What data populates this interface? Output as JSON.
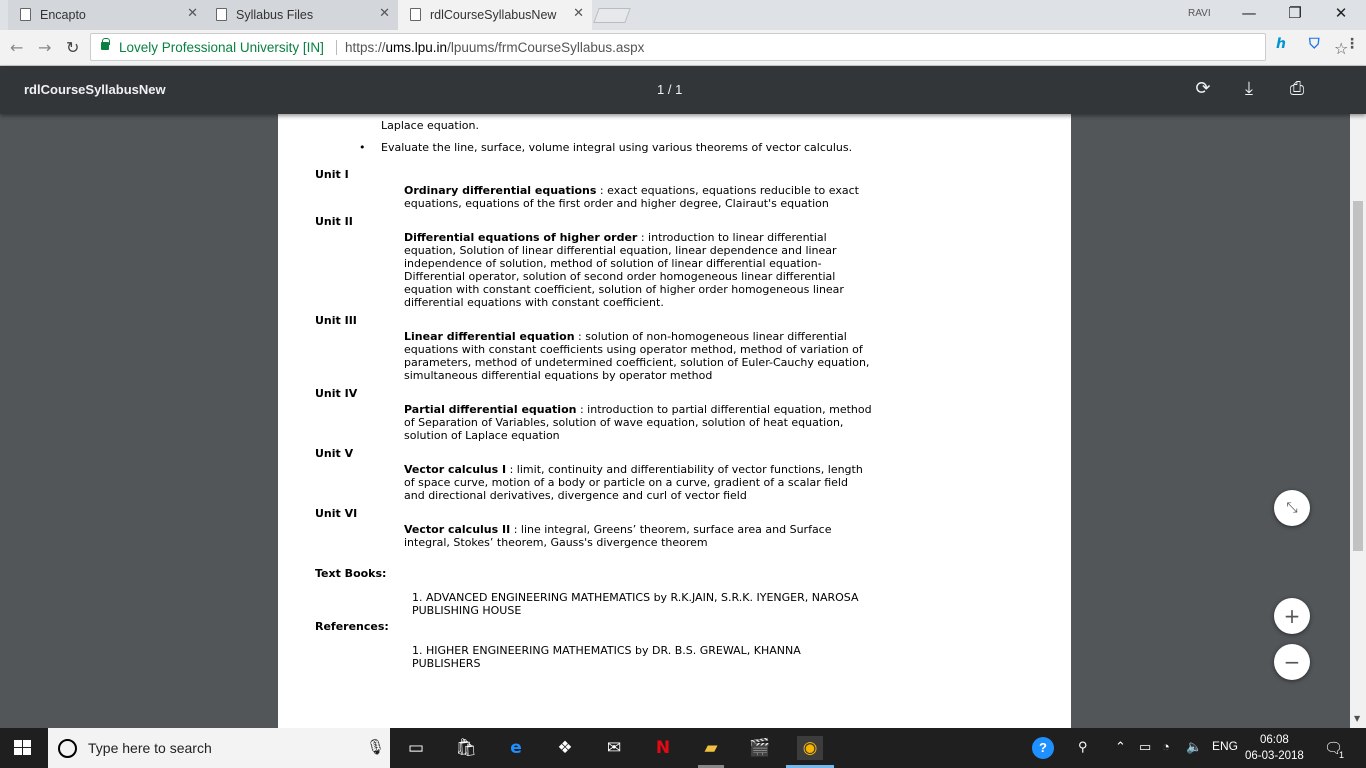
{
  "tabs": [
    {
      "label": "Encapto"
    },
    {
      "label": "Syllabus Files"
    },
    {
      "label": "rdlCourseSyllabusNew"
    }
  ],
  "window": {
    "user": "RAVI"
  },
  "omnibox": {
    "site_name": "Lovely Professional University [IN]",
    "url_scheme": "https://",
    "url_domain": "ums.lpu.in",
    "url_path": "/lpuums/frmCourseSyllabus.aspx"
  },
  "pdf": {
    "title": "rdlCourseSyllabusNew",
    "page_indicator": "1 / 1"
  },
  "document": {
    "outcome_partial": "Laplace equation.",
    "outcome_last": "Evaluate the line, surface, volume integral using various theorems of vector calculus.",
    "units": [
      {
        "label": "Unit I",
        "topic": "Ordinary differential equations",
        "desc": " : exact equations, equations reducible to exact equations, equations of the first order and higher degree, Clairaut's equation"
      },
      {
        "label": "Unit II",
        "topic": "Differential equations of higher order",
        "desc": " : introduction to linear differential equation, Solution of linear differential equation, linear dependence and linear independence of solution, method of solution of linear differential equation-Differential operator, solution of second order homogeneous linear differential equation with constant coefficient, solution of higher order homogeneous linear differential equations with constant coefficient."
      },
      {
        "label": "Unit III",
        "topic": "Linear differential equation",
        "desc": " : solution of non-homogeneous linear differential equations with constant coefficients using operator method, method of variation of parameters, method of undetermined coefficient, solution of Euler-Cauchy equation, simultaneous differential equations by operator method"
      },
      {
        "label": "Unit IV",
        "topic": "Partial differential equation",
        "desc": " : introduction to partial differential equation, method of Separation of Variables, solution of wave equation, solution of heat equation, solution of Laplace equation"
      },
      {
        "label": "Unit V",
        "topic": "Vector calculus I",
        "desc": " : limit, continuity and differentiability of vector functions, length of space curve, motion of a body or particle on a curve, gradient of a scalar field and directional derivatives, divergence and curl of vector field"
      },
      {
        "label": "Unit VI",
        "topic": "Vector calculus II",
        "desc": " : line integral, Greens’ theorem, surface area and Surface integral, Stokes’ theorem, Gauss's divergence theorem"
      }
    ],
    "text_books_heading": "Text Books:",
    "text_book_1": "1. ADVANCED ENGINEERING MATHEMATICS by R.K.JAIN, S.R.K. IYENGER, NAROSA PUBLISHING HOUSE",
    "references_heading": "References:",
    "reference_1": "1. HIGHER ENGINEERING MATHEMATICS by DR. B.S. GREWAL, KHANNA PUBLISHERS"
  },
  "taskbar": {
    "search_placeholder": "Type here to search",
    "language": "ENG",
    "time": "06:08",
    "date": "06-03-2018",
    "notification_count": "1"
  }
}
